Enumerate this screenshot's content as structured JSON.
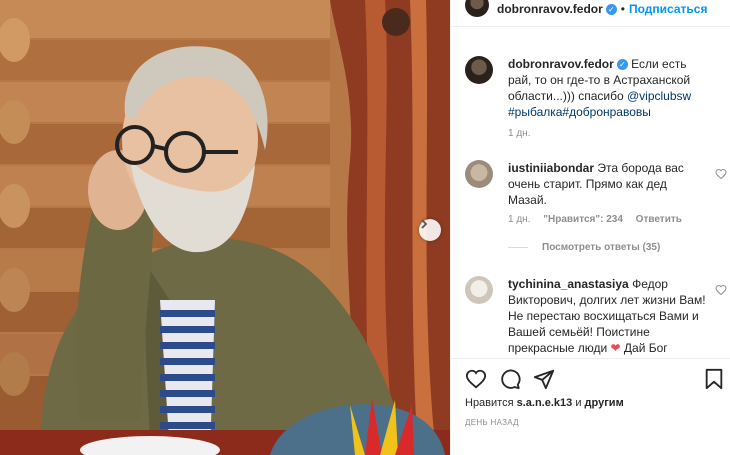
{
  "post": {
    "author": "dobronravov.fedor",
    "follow_label": "Подписаться",
    "separator": "•",
    "verified_mark": "✓"
  },
  "caption": {
    "author": "dobronravov.fedor",
    "text_before": "Если есть рай, то он где-то в Астраханской области...))) спасибо",
    "mention": "@vipclubsw",
    "hashtags": "#рыбалка#добронравовы",
    "time": "1 дн."
  },
  "comments": [
    {
      "author": "iustiniiabondar",
      "text": "Эта борода вас очень старит. Прямо как дед Мазай.",
      "time": "1 дн.",
      "likes": "\"Нравится\": 234",
      "reply_label": "Ответить",
      "replies_label": "Посмотреть ответы (35)"
    },
    {
      "author": "tychinina_anastasiya",
      "text": "Федор Викторович, долгих лет жизни Вам! Не перестаю восхищаться Вами и Вашей семьёй! Поистине прекрасные люди",
      "emoji": "❤",
      "text_after": "Дай Бог"
    }
  ],
  "likes": {
    "prefix": "Нравится",
    "user": "s.a.n.e.k13",
    "connector": "и",
    "suffix": "другим"
  },
  "time_ago": "ДЕНЬ НАЗАД",
  "icons": [
    "heart-icon",
    "comment-icon",
    "share-icon",
    "bookmark-icon",
    "next-arrow-icon",
    "verified-icon"
  ],
  "colors": {
    "accent": "#0095f6",
    "verified": "#3897f0",
    "heart": "#ed4956",
    "muted": "#8e8e8e"
  }
}
